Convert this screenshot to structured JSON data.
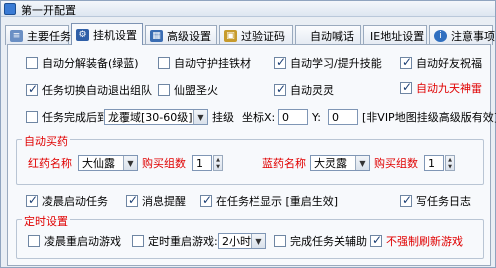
{
  "window": {
    "title": "第一开配置"
  },
  "tabs": [
    {
      "label": "主要任务"
    },
    {
      "label": "挂机设置"
    },
    {
      "label": "高级设置"
    },
    {
      "label": "过验证码"
    },
    {
      "label": "自动喊话"
    },
    {
      "label": "IE地址设置"
    },
    {
      "label": "注意事项"
    }
  ],
  "options": {
    "auto_decompose": {
      "label": "自动分解装备(绿蓝)",
      "checked": false
    },
    "auto_guard_ore": {
      "label": "自动守护挂铁材",
      "checked": false
    },
    "auto_learn_skill": {
      "label": "自动学习/提升技能",
      "checked": true
    },
    "auto_friend_bless": {
      "label": "自动好友祝福",
      "checked": true
    },
    "task_switch_leave_team": {
      "label": "任务切换自动退出组队",
      "checked": true
    },
    "immortal_fire": {
      "label": "仙盟圣火",
      "checked": false
    },
    "auto_spirit": {
      "label": "自动灵灵",
      "checked": true
    },
    "auto_nine_days": {
      "label": "自动九天神雷",
      "checked": true
    },
    "dawn_start_task": {
      "label": "凌晨启动任务",
      "checked": true
    },
    "msg_alert": {
      "label": "消息提醒",
      "checked": true
    },
    "taskbar_show": {
      "label": "在任务栏显示 [重启生效]",
      "checked": true
    },
    "write_log": {
      "label": "写任务日志",
      "checked": true
    }
  },
  "task_done": {
    "label": "任务完成后到",
    "map": "龙覆域[30-60级]",
    "hang_label": "挂级",
    "coord_x_label": "坐标X:",
    "coord_x": "0",
    "coord_y_label": "Y:",
    "coord_y": "0",
    "note": "[非VIP地图挂级高级版有效]"
  },
  "auto_buy": {
    "title": "自动买药",
    "red_label": "红药名称",
    "red_value": "大仙露",
    "red_count_label": "购买组数",
    "red_count": "1",
    "blue_label": "蓝药名称",
    "blue_value": "大灵露",
    "blue_count_label": "购买组数",
    "blue_count": "1"
  },
  "timer": {
    "title": "定时设置",
    "dawn_restart": {
      "label": "凌晨重启动游戏",
      "checked": false
    },
    "timed_restart": {
      "label": "定时重启游戏:",
      "checked": false
    },
    "interval": "2小时",
    "task_done_close": {
      "label": "完成任务关辅助",
      "checked": false
    },
    "no_force_refresh": {
      "label": "不强制刷新游戏",
      "checked": true
    }
  },
  "colors": {
    "accent_red": "#e00000",
    "panel_bg": "#f7f9fc"
  }
}
